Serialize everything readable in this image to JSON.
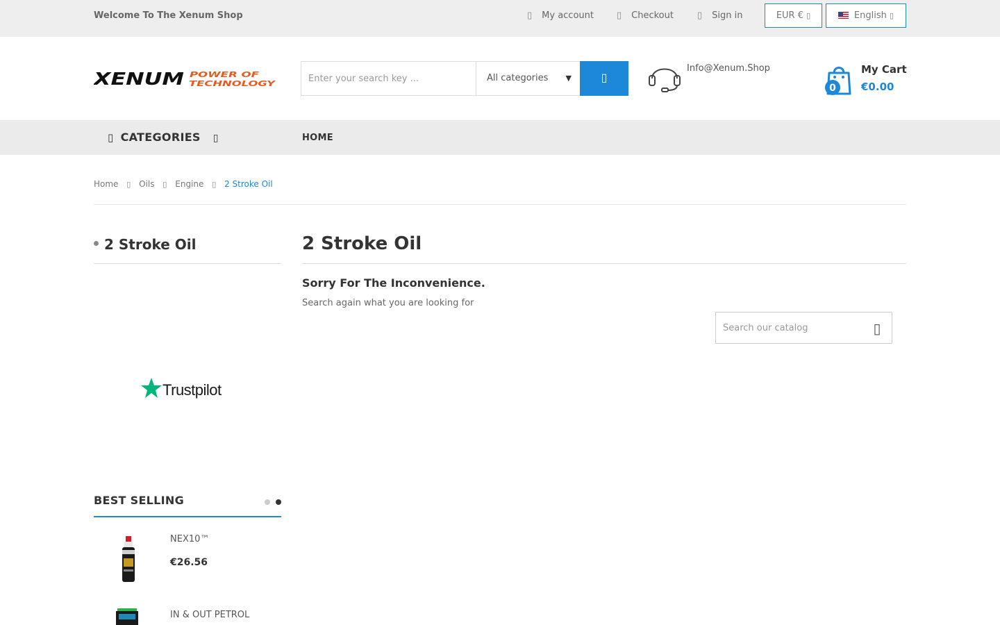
{
  "topbar": {
    "welcome": "Welcome To The Xenum Shop",
    "my_account": "My account",
    "checkout": "Checkout",
    "sign_in": "Sign in",
    "currency": "EUR €",
    "language": "English"
  },
  "header": {
    "logo": {
      "brand": "XENUM",
      "tagline_1": "POWER OF",
      "tagline_2": "TECHNOLOGY"
    },
    "search_placeholder": "Enter your search key ...",
    "category_select": "All categories",
    "contact_email": "Info@Xenum.Shop",
    "cart": {
      "title": "My Cart",
      "total": "€0.00",
      "count": "0"
    }
  },
  "nav": {
    "categories": "CATEGORIES",
    "home": "HOME"
  },
  "breadcrumb": [
    "Home",
    "Oils",
    "Engine",
    "2 Stroke Oil"
  ],
  "sidebar": {
    "title": "2 Stroke Oil",
    "trustpilot": "Trustpilot",
    "best_selling": {
      "title": "BEST SELLING",
      "products": [
        {
          "name": "NEX10™",
          "price": "€26.56"
        },
        {
          "name": "IN & OUT PETROL",
          "price": ""
        }
      ]
    }
  },
  "main": {
    "title": "2 Stroke Oil",
    "sorry": "Sorry For The Inconvenience.",
    "search_again": "Search again what you are looking for",
    "catalog_placeholder": "Search our catalog"
  },
  "colors": {
    "accent": "#1e88d8",
    "logo_orange": "#e85a1c",
    "trustpilot_green": "#00b67a"
  },
  "icons": [
    "user-icon",
    "check-icon",
    "lock-icon",
    "chevron-down-icon",
    "search-icon",
    "headset-icon",
    "shopping-bag-icon",
    "menu-icon",
    "chevron-right-icon",
    "star-icon"
  ]
}
